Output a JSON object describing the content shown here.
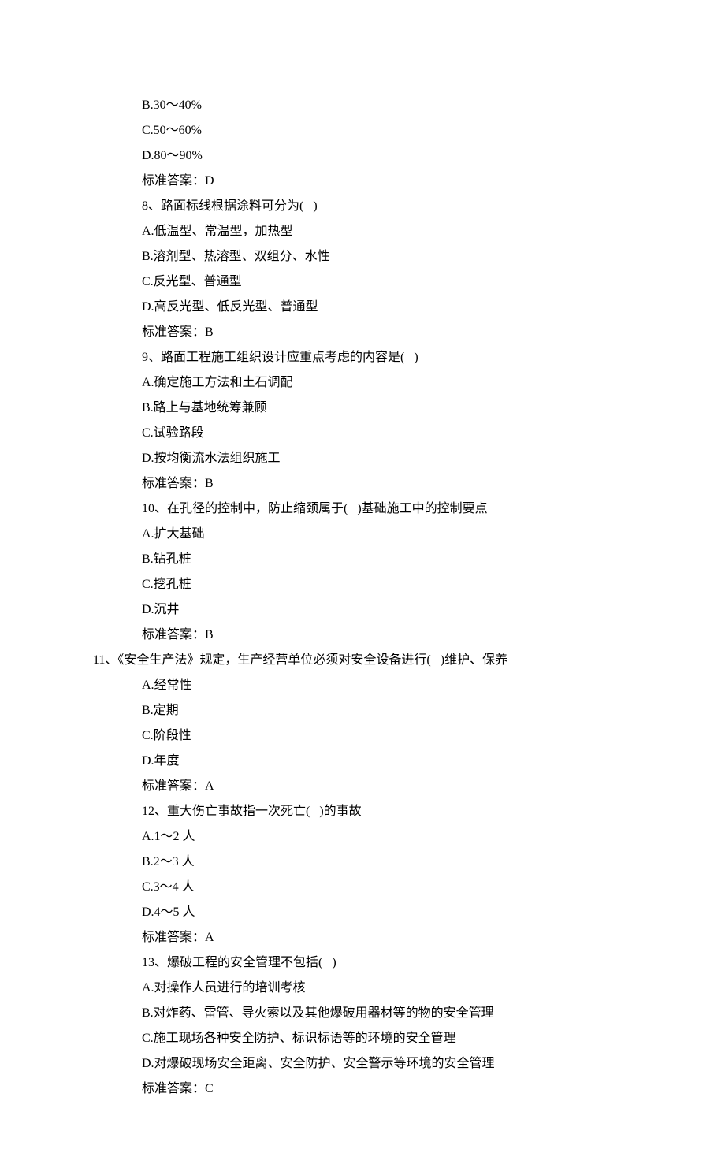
{
  "lines": [
    {
      "indent": 1,
      "text": "B.30～40%"
    },
    {
      "indent": 1,
      "text": "C.50～60%"
    },
    {
      "indent": 1,
      "text": "D.80～90%"
    },
    {
      "indent": 1,
      "text": "标准答案：D"
    },
    {
      "indent": 1,
      "text": "8、路面标线根据涂料可分为(   )"
    },
    {
      "indent": 1,
      "text": "A.低温型、常温型，加热型"
    },
    {
      "indent": 1,
      "text": "B.溶剂型、热溶型、双组分、水性"
    },
    {
      "indent": 1,
      "text": "C.反光型、普通型"
    },
    {
      "indent": 1,
      "text": "D.高反光型、低反光型、普通型"
    },
    {
      "indent": 1,
      "text": "标准答案：B"
    },
    {
      "indent": 1,
      "text": "9、路面工程施工组织设计应重点考虑的内容是(   )"
    },
    {
      "indent": 1,
      "text": "A.确定施工方法和土石调配"
    },
    {
      "indent": 1,
      "text": "B.路上与基地统筹兼顾"
    },
    {
      "indent": 1,
      "text": "C.试验路段"
    },
    {
      "indent": 1,
      "text": "D.按均衡流水法组织施工"
    },
    {
      "indent": 1,
      "text": "标准答案：B"
    },
    {
      "indent": 1,
      "text": "10、在孔径的控制中，防止缩颈属于(   )基础施工中的控制要点"
    },
    {
      "indent": 1,
      "text": "A.扩大基础"
    },
    {
      "indent": 1,
      "text": "B.钻孔桩"
    },
    {
      "indent": 1,
      "text": "C.挖孔桩"
    },
    {
      "indent": 1,
      "text": "D.沉井"
    },
    {
      "indent": 1,
      "text": "标准答案：B"
    },
    {
      "indent": 0,
      "text": "11、《安全生产法》规定，生产经营单位必须对安全设备进行(   )维护、保养"
    },
    {
      "indent": 1,
      "text": "A.经常性"
    },
    {
      "indent": 1,
      "text": "B.定期"
    },
    {
      "indent": 1,
      "text": "C.阶段性"
    },
    {
      "indent": 1,
      "text": "D.年度"
    },
    {
      "indent": 1,
      "text": "标准答案：A"
    },
    {
      "indent": 1,
      "text": "12、重大伤亡事故指一次死亡(   )的事故"
    },
    {
      "indent": 1,
      "text": "A.1～2 人"
    },
    {
      "indent": 1,
      "text": "B.2～3 人"
    },
    {
      "indent": 1,
      "text": "C.3～4 人"
    },
    {
      "indent": 1,
      "text": "D.4～5 人"
    },
    {
      "indent": 1,
      "text": "标准答案：A"
    },
    {
      "indent": 1,
      "text": "13、爆破工程的安全管理不包括(   )"
    },
    {
      "indent": 1,
      "text": "A.对操作人员进行的培训考核"
    },
    {
      "indent": 1,
      "text": "B.对炸药、雷管、导火索以及其他爆破用器材等的物的安全管理"
    },
    {
      "indent": 1,
      "text": "C.施工现场各种安全防护、标识标语等的环境的安全管理"
    },
    {
      "indent": 1,
      "text": "D.对爆破现场安全距离、安全防护、安全警示等环境的安全管理"
    },
    {
      "indent": 1,
      "text": "标准答案：C"
    }
  ]
}
